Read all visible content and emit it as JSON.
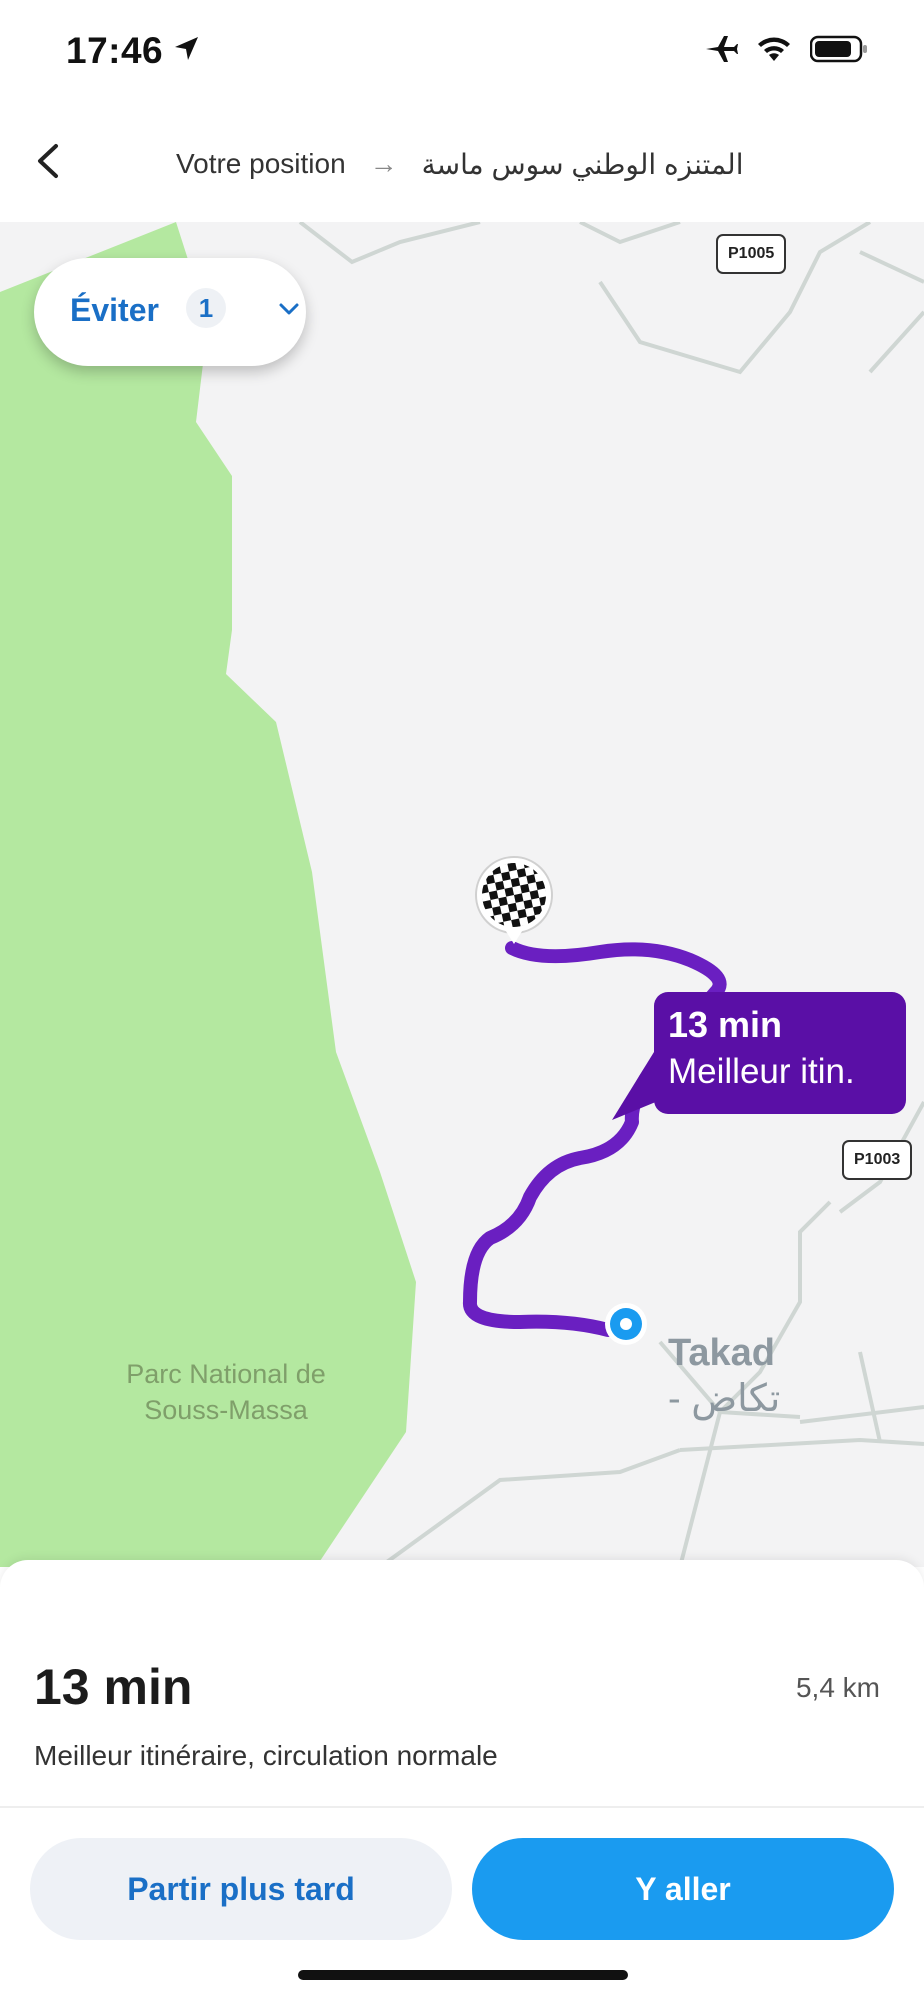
{
  "status_bar": {
    "time": "17:46",
    "icons": [
      "location-arrow-icon",
      "airplane-icon",
      "wifi-icon",
      "battery-icon"
    ]
  },
  "nav": {
    "back_icon": "chevron-left-icon",
    "origin": "Votre position",
    "arrow": "→",
    "destination": "المتنزه الوطني سوس ماسة"
  },
  "map": {
    "avoid": {
      "label": "Éviter",
      "count": "1",
      "icon": "chevron-down-icon"
    },
    "road_badges": [
      "P1005",
      "P1003"
    ],
    "park_label": {
      "line1": "Parc National de",
      "line2": "Souss-Massa"
    },
    "town_label": {
      "latin": "Takad",
      "arabic": "تكاض -"
    },
    "route_bubble": {
      "duration": "13 min",
      "label": "Meilleur itin."
    },
    "colors": {
      "route": "#6a1fc1",
      "park": "#b4e8a0",
      "land": "#f3f3f4",
      "current_location": "#1a9bf0"
    }
  },
  "sheet": {
    "duration": "13 min",
    "distance": "5,4 km",
    "summary": "Meilleur itinéraire, circulation normale",
    "later_label": "Partir plus tard",
    "go_label": "Y aller",
    "colors": {
      "go_button": "#1a9bf0",
      "later_button": "#eef1f6",
      "accent_text": "#1a6fc6"
    }
  }
}
